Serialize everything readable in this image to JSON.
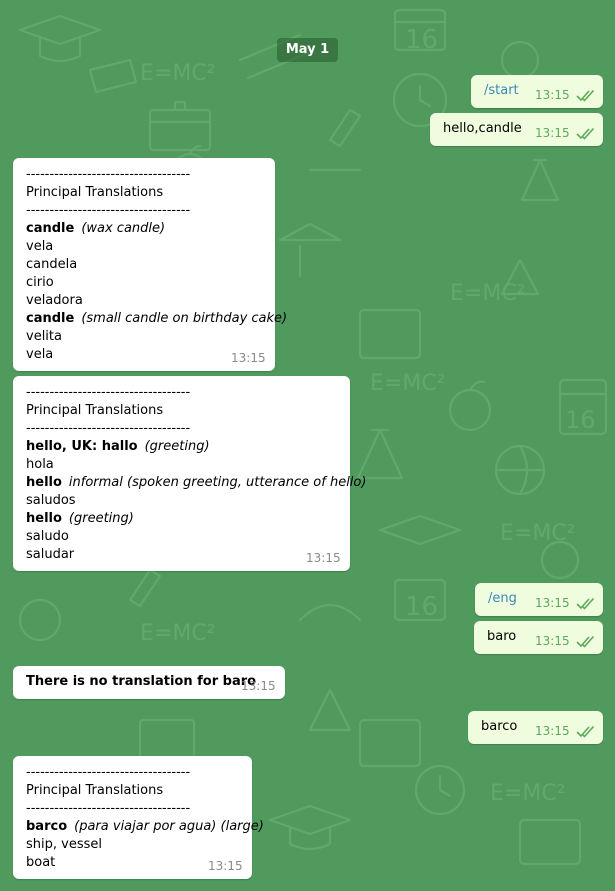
{
  "date_label": "May 1",
  "colors": {
    "background": "#4f9a5c",
    "outgoing": "#effdde",
    "incoming": "#ffffff",
    "command": "#3a88b8",
    "check": "#5fa85c"
  },
  "out1": {
    "text": "/start",
    "time": "13:15"
  },
  "out2": {
    "text": "hello,candle",
    "time": "13:15"
  },
  "in1": {
    "sep1": "-----------------------------------",
    "heading": "Principal Translations",
    "sep2": "-----------------------------------",
    "e1_word": "candle",
    "e1_note": "(wax candle)",
    "e1_t1": "vela",
    "e1_t2": "candela",
    "e1_t3": "cirio",
    "e1_t4": "veladora",
    "e2_word": "candle",
    "e2_note": "(small candle on birthday cake)",
    "e2_t1": "velita",
    "e2_t2": "vela",
    "time": "13:15"
  },
  "in2": {
    "sep1": "-----------------------------------",
    "heading": "Principal Translations",
    "sep2": "-----------------------------------",
    "e1_word": "hello, UK: hallo",
    "e1_note": "(greeting)",
    "e1_t1": "hola",
    "e2_word": "hello",
    "e2_note": "informal (spoken greeting, utterance of hello)",
    "e2_t1": "saludos",
    "e3_word": "hello",
    "e3_note": "(greeting)",
    "e3_t1": "saludo",
    "e3_t2": "saludar",
    "time": "13:15"
  },
  "out3": {
    "text": "/eng",
    "time": "13:15"
  },
  "out4": {
    "text": "baro",
    "time": "13:15"
  },
  "in3": {
    "text": "There is no translation for baro",
    "time": "13:15"
  },
  "out5": {
    "text": "barco",
    "time": "13:15"
  },
  "in4": {
    "sep1": "-----------------------------------",
    "heading": "Principal Translations",
    "sep2": "-----------------------------------",
    "e1_word": "barco",
    "e1_note": "(para viajar por agua) (large)",
    "e1_t1": "ship, vessel",
    "e1_t2": "boat",
    "time": "13:15"
  }
}
